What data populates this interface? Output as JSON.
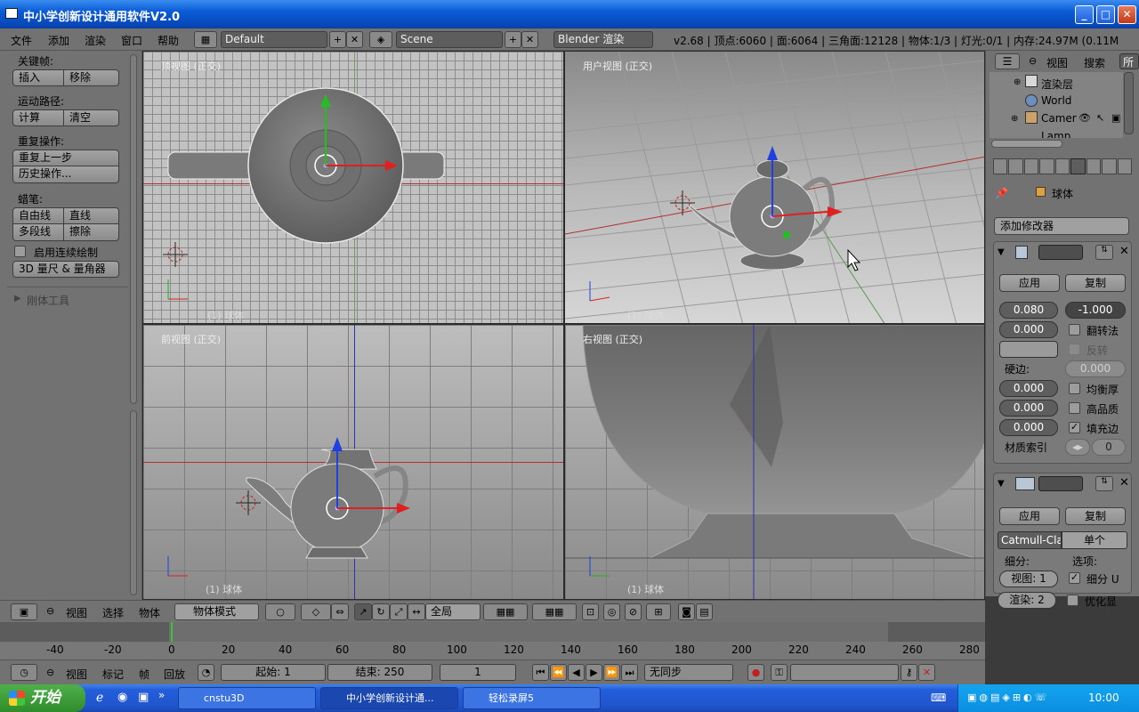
{
  "window": {
    "title": "中小学创新设计通用软件V2.0"
  },
  "header": {
    "menus": [
      "文件",
      "添加",
      "渲染",
      "窗口",
      "帮助"
    ],
    "layout": "Default",
    "scene": "Scene",
    "render_engine": "Blender 渲染",
    "stats": "v2.68 | 顶点:6060 | 面:6064 | 三角面:12128 | 物体:1/3 | 灯光:0/1 | 内存:24.97M (0.11M"
  },
  "toolshelf": {
    "keyframes_label": "关键帧:",
    "insert": "插入",
    "remove": "移除",
    "motion_paths_label": "运动路径:",
    "calculate": "计算",
    "clear": "清空",
    "repeat_label": "重复操作:",
    "repeat_last": "重复上一步",
    "history": "历史操作...",
    "grease_label": "蜡笔:",
    "freehand": "自由线",
    "line": "直线",
    "poly": "多段线",
    "erase": "擦除",
    "continuous": "启用连续绘制",
    "ruler": "3D 量尺 & 量角器",
    "rigid_tools": "刚体工具"
  },
  "viewports": {
    "top": {
      "label": "顶视图 (正交)",
      "object": "(1) 球体"
    },
    "user": {
      "label": "用户视图 (正交)",
      "object": "(1) 球体"
    },
    "front": {
      "label": "前视图 (正交)",
      "object": "(1) 球体"
    },
    "right": {
      "label": "右视图 (正交)",
      "object": "(1) 球体"
    }
  },
  "outliner": {
    "view": "视图",
    "search": "搜索",
    "all": "所",
    "items": [
      "渲染层",
      "World",
      "Camera",
      "Lamp"
    ]
  },
  "properties": {
    "object_name": "球体",
    "add_modifier": "添加修改器",
    "mod1": {
      "apply": "应用",
      "copy": "复制",
      "thickness": "0.080",
      "offset": "-1.000",
      "val2": "0.000",
      "flip_normals": "翻转法",
      "invert": "反转",
      "edge_label": "硬边:",
      "edge_val": "0.000",
      "crease1": "0.000",
      "even_thickness": "均衡厚",
      "crease2": "0.000",
      "high_quality": "高品质",
      "crease3": "0.000",
      "fill_rim": "填充边",
      "material_index": "材质索引",
      "mat_val": "0"
    },
    "mod2": {
      "apply": "应用",
      "copy": "复制",
      "algo": "Catmull-Cla",
      "simple": "单个",
      "subdiv_label": "细分:",
      "options_label": "选项:",
      "view_levels": "视图: 1",
      "render_levels": "渲染: 2",
      "subdiv_uv": "细分 U",
      "optimal": "优化显"
    }
  },
  "vpheader": {
    "view": "视图",
    "select": "选择",
    "object": "物体",
    "mode": "物体模式",
    "global": "全局"
  },
  "timeline": {
    "ticks": [
      "-40",
      "-20",
      "0",
      "20",
      "40",
      "60",
      "80",
      "100",
      "120",
      "140",
      "160",
      "180",
      "200",
      "220",
      "240",
      "260",
      "280"
    ],
    "view": "视图",
    "marker": "标记",
    "frame": "帧",
    "playback": "回放",
    "start": "起始: 1",
    "end": "结束: 250",
    "current": "1",
    "sync": "无同步"
  },
  "taskbar": {
    "start": "开始",
    "tasks": [
      "cnstu3D",
      "中小学创新设计通...",
      "轻松录屏5"
    ],
    "clock": "10:00"
  }
}
